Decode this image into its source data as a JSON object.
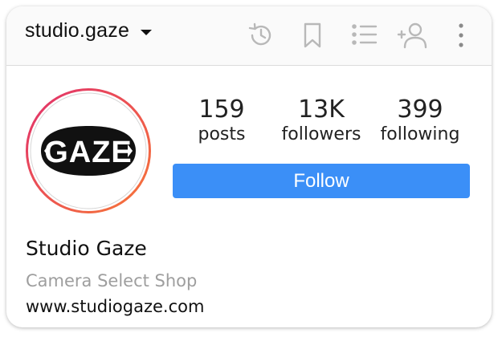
{
  "header": {
    "account_name": "studio.gaze",
    "icons": [
      "history-icon",
      "bookmark-icon",
      "list-icon",
      "add-user-icon",
      "more-icon"
    ]
  },
  "profile": {
    "logo_text": "GAZE",
    "stats": [
      {
        "value": "159",
        "label": "posts"
      },
      {
        "value": "13K",
        "label": "followers"
      },
      {
        "value": "399",
        "label": "following"
      }
    ],
    "follow_label": "Follow",
    "display_name": "Studio Gaze",
    "bio": "Camera Select Shop",
    "website": "www.studiogaze.com"
  },
  "colors": {
    "accent": "#3b8ff7",
    "story_ring_start": "#e1306c",
    "story_ring_end": "#f77737",
    "muted_text": "#9e9e9e"
  }
}
